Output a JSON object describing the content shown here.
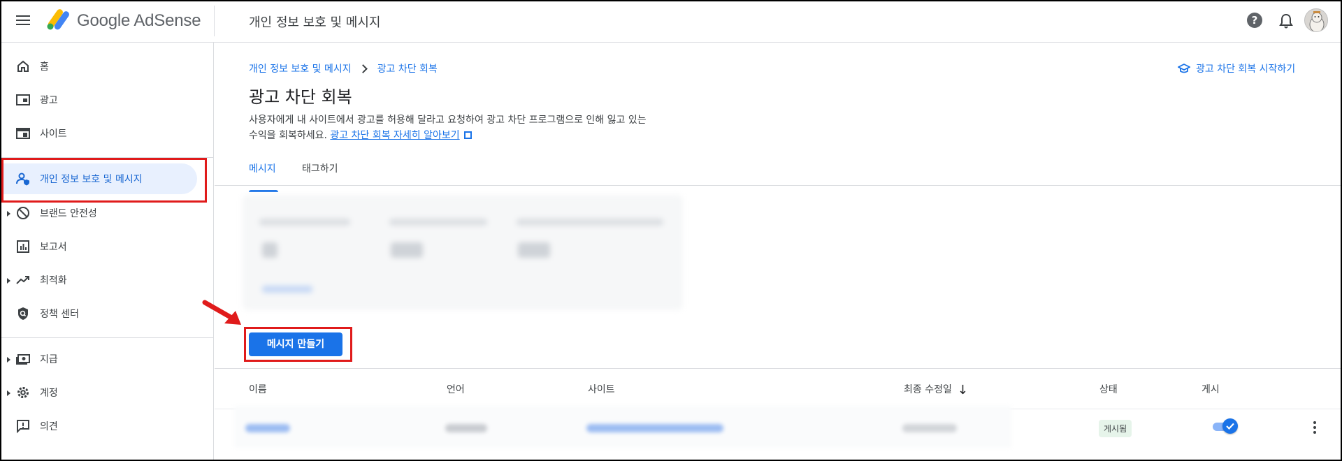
{
  "header": {
    "product_name": "Google AdSense",
    "page_title": "개인 정보 보호 및 메시지",
    "help_icon": "help-icon",
    "bell_icon": "notifications-icon",
    "avatar_icon": "user-avatar"
  },
  "sidebar": {
    "items": [
      {
        "label": "홈",
        "icon": "home-icon"
      },
      {
        "label": "광고",
        "icon": "ads-icon"
      },
      {
        "label": "사이트",
        "icon": "sites-icon"
      },
      {
        "label": "개인 정보 보호 및 메시지",
        "icon": "privacy-user-icon",
        "active": true
      },
      {
        "label": "브랜드 안전성",
        "icon": "block-icon"
      },
      {
        "label": "보고서",
        "icon": "reports-icon"
      },
      {
        "label": "최적화",
        "icon": "trending-icon"
      },
      {
        "label": "정책 센터",
        "icon": "policy-shield-icon"
      },
      {
        "label": "지급",
        "icon": "payments-icon"
      },
      {
        "label": "계정",
        "icon": "settings-gear-icon"
      },
      {
        "label": "의견",
        "icon": "feedback-icon"
      }
    ]
  },
  "main": {
    "breadcrumb": [
      "개인 정보 보호 및 메시지",
      "광고 차단 회복"
    ],
    "start_link": "광고 차단 회복 시작하기",
    "title": "광고 차단 회복",
    "description_line1": "사용자에게 내 사이트에서 광고를 허용해 달라고 요청하여 광고 차단 프로그램으로 인해 잃고 있는",
    "description_line2": "수익을 회복하세요.",
    "learn_more": "광고 차단 회복 자세히 알아보기",
    "tabs": [
      "메시지",
      "태그하기"
    ],
    "create_button": "메시지 만들기",
    "table": {
      "headers": [
        "이름",
        "언어",
        "사이트",
        "최종 수정일",
        "상태",
        "게시"
      ],
      "rows": [
        {
          "status": "게시됨",
          "published": true
        }
      ]
    }
  },
  "colors": {
    "accent": "#1a73e8",
    "active_bg": "#e8f0fe",
    "annotation_red": "#e01b1b",
    "status_bg": "#e6f4ea"
  }
}
